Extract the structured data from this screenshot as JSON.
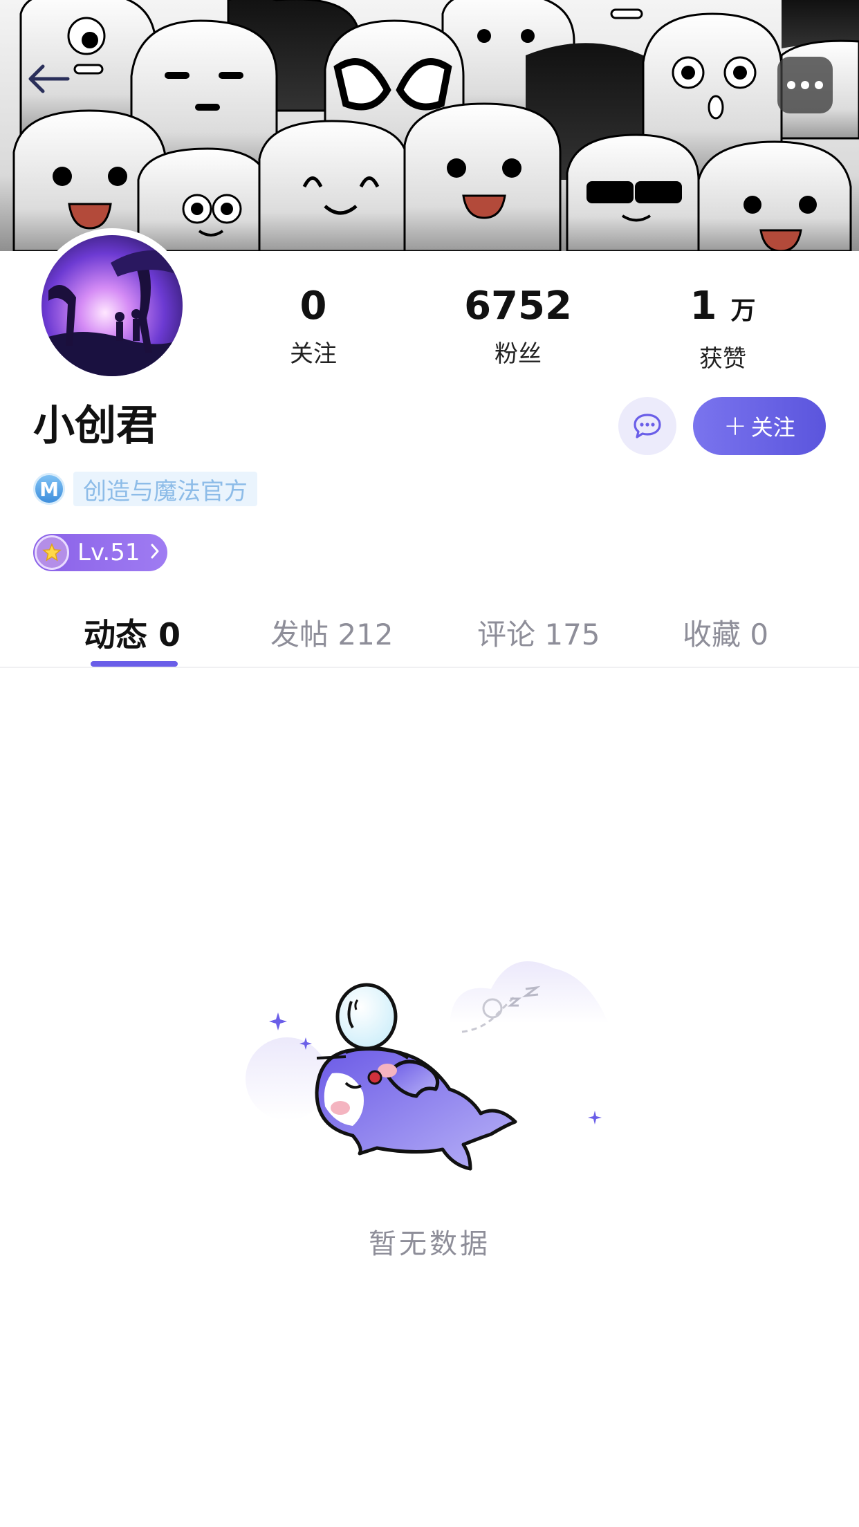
{
  "header": {
    "back_icon": "arrow-left-icon",
    "more_icon": "more-dots-icon"
  },
  "profile": {
    "name": "小创君",
    "official_badge": "M",
    "official_tag": "创造与魔法官方",
    "level": "Lv.51"
  },
  "stats": [
    {
      "value": "0",
      "unit": "",
      "label": "关注"
    },
    {
      "value": "6752",
      "unit": "",
      "label": "粉丝"
    },
    {
      "value": "1",
      "unit": "万",
      "label": "获赞"
    }
  ],
  "actions": {
    "message_icon": "chat-bubble-icon",
    "follow_plus": "+",
    "follow_label": "关注"
  },
  "tabs": [
    {
      "label": "动态 0",
      "active": true
    },
    {
      "label": "发帖 212",
      "active": false
    },
    {
      "label": "评论 175",
      "active": false
    },
    {
      "label": "收藏 0",
      "active": false
    }
  ],
  "empty_state": {
    "text": "暂无数据"
  },
  "colors": {
    "accent": "#6a5ee8",
    "follow_button": "#6b65e6",
    "official_tag_bg": "#eaf4fd",
    "official_tag_text": "#8dbce8",
    "muted_text": "#8e8e99"
  }
}
